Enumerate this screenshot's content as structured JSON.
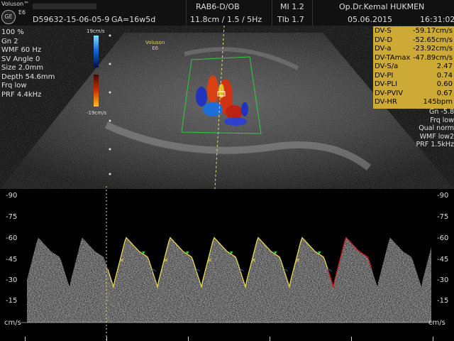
{
  "header": {
    "brand": "Voluson™",
    "model": "E6",
    "logo_text": "GE",
    "patient_id": "D59632-15-06-05-9",
    "ga": "GA=16w5d",
    "probe": "RAB6-D/OB",
    "mi": "MI  1.2",
    "operator": "Op.Dr.Kemal HUKMEN",
    "imaging": "11.8cm / 1.5 /  5Hz",
    "tib": "Tlb  1.7",
    "date": "05.06.2015",
    "time": "16:31:02"
  },
  "left_params": [
    "100 %",
    "Gn  2",
    "WMF 60 Hz",
    "SV Angle  0",
    "Size  2.0mm",
    "Depth 54.6mm",
    "Frq low",
    "PRF  4.4kHz"
  ],
  "colorbar": {
    "top": "19cm/s",
    "bottom": "-19cm/s"
  },
  "probe_label": {
    "line1": "Voluson",
    "line2": "E6"
  },
  "measurements": [
    {
      "label": "DV-S",
      "value": "-59.17cm/s"
    },
    {
      "label": "DV-D",
      "value": "-52.65cm/s"
    },
    {
      "label": "DV-a",
      "value": "-23.92cm/s"
    },
    {
      "label": "DV-TAmax",
      "value": "-47.89cm/s"
    },
    {
      "label": "DV-S/a",
      "value": "2.47"
    },
    {
      "label": "DV-PI",
      "value": "0.74"
    },
    {
      "label": "DV-PLI",
      "value": "0.60"
    },
    {
      "label": "DV-PVIV",
      "value": "0.67"
    },
    {
      "label": "DV-HR",
      "value": "145bpm"
    }
  ],
  "right_params": [
    "Gn -5.8",
    "Frq low",
    "Qual norm",
    "WMF low2",
    "PRF  1.5kHz"
  ],
  "doppler": {
    "unit": "cm/s",
    "ticks": [
      "-90",
      "-75",
      "-60",
      "-45",
      "-30",
      "-15"
    ]
  },
  "colors": {
    "panel": "#cda936",
    "trace": "#e8d84a",
    "trace_last": "#d02020",
    "marker": "#2a4de0",
    "marker_green": "#2ecc40"
  }
}
